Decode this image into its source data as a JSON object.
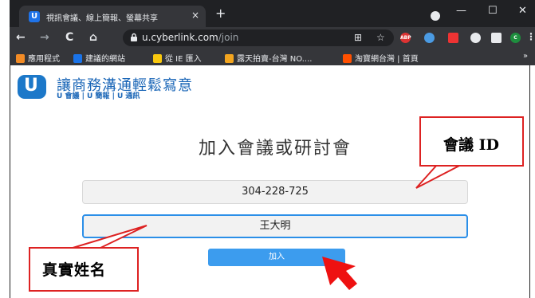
{
  "browser": {
    "tab_title": "視訊會議、線上簡報、螢幕共享",
    "tab_close": "×",
    "new_tab": "+",
    "window": {
      "minimize": "—",
      "maximize": "☐",
      "close": "✕"
    },
    "nav": {
      "back": "←",
      "forward": "→",
      "reload": "C",
      "home": "⌂"
    },
    "url_host": "u.cyberlink.com",
    "url_path": "/join",
    "extensions": [
      "ABP",
      "C"
    ]
  },
  "bookmarks": [
    {
      "label": "應用程式",
      "color": "#f28b25"
    },
    {
      "label": "建議的網站",
      "color": "#1a73e8"
    },
    {
      "label": "從 IE 匯入",
      "color": "#f9c80e"
    },
    {
      "label": "露天拍賣-台灣 NO....",
      "color": "#f3a51f"
    },
    {
      "label": "淘寶網台灣 | 首頁",
      "color": "#ff5000"
    }
  ],
  "brand": {
    "logo_letter": "U",
    "title": "讓商務溝通輕鬆寫意",
    "subtitle": "U 會議 | U 簡報 | U 通訊"
  },
  "join": {
    "heading": "加入會議或研討會",
    "meeting_id_value": "304-228-725",
    "name_value": "王大明",
    "button_label": "加入"
  },
  "annotations": {
    "meeting_id_label": "會議 ID",
    "real_name_label": "真實姓名"
  },
  "colors": {
    "accent": "#3c9cee",
    "brand_blue": "#1a66b7",
    "annotation_red": "#dd2222"
  }
}
